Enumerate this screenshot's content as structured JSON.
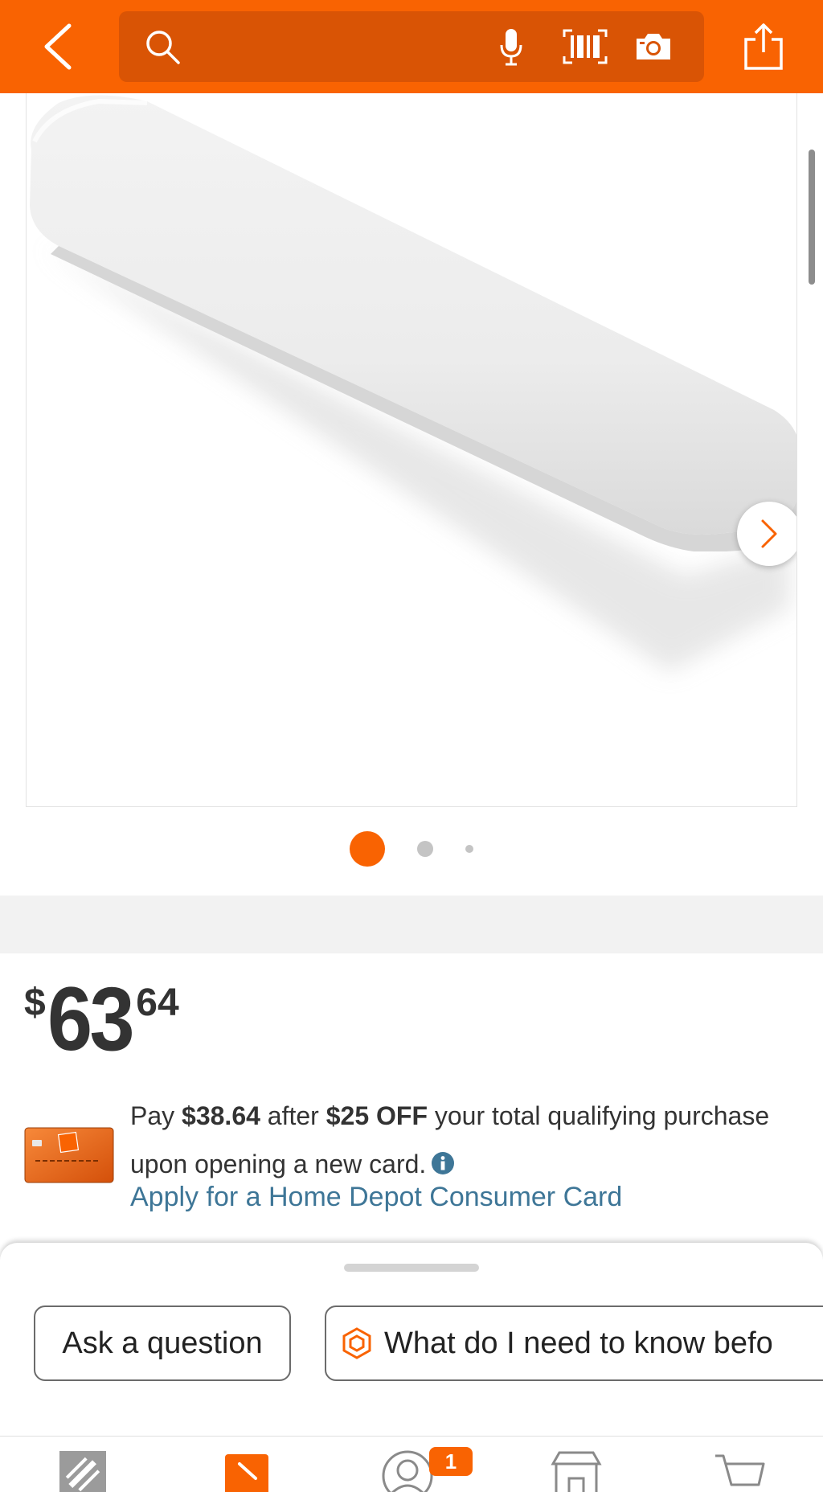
{
  "header": {
    "search_placeholder": "",
    "icons": [
      "back-chevron",
      "search",
      "microphone",
      "barcode",
      "camera",
      "share"
    ]
  },
  "gallery": {
    "current_index": 1,
    "total_images": 3
  },
  "product": {
    "price": {
      "currency": "$",
      "dollars": "63",
      "cents": "64"
    }
  },
  "offer": {
    "line_pay": "Pay ",
    "pay_amount": "$38.64",
    "line_after": " after ",
    "discount": "$25 OFF",
    "line_rest": " your total qualifying purchase upon opening a new card.",
    "apply_link": "Apply for a Home Depot Consumer Card"
  },
  "sheet": {
    "chips": [
      {
        "label": "Ask a question"
      },
      {
        "label": "What do I need to know befo"
      }
    ]
  },
  "nav": {
    "items": [
      "home",
      "shop",
      "account",
      "store",
      "cart"
    ],
    "account_badge": "1"
  },
  "colors": {
    "brand_orange": "#f96302",
    "search_bg": "#d95405",
    "link_blue": "#3e7697",
    "text": "#333333"
  }
}
